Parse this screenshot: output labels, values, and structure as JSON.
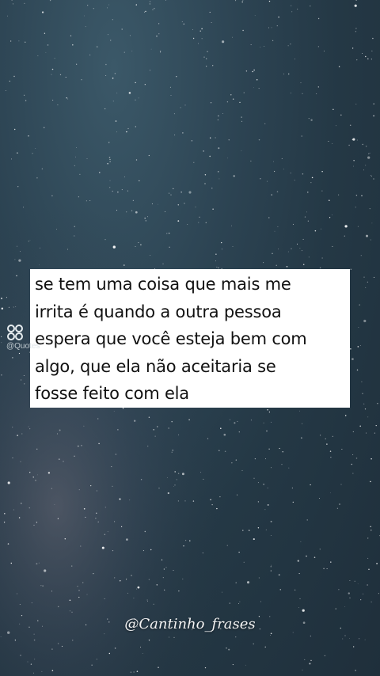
{
  "quote": {
    "lines": [
      "se tem uma coisa que mais me",
      "irrita é quando a outra pessoa",
      "espera que você esteja bem com",
      "algo, que ela não aceitaria se",
      "fosse feito com ela"
    ]
  },
  "watermark": {
    "icon": "quotes-app-icon",
    "handle": "@Quotes"
  },
  "credit": {
    "handle": "@Cantinho_frases"
  },
  "colors": {
    "sky_top": "#3b5868",
    "sky_bottom": "#1f2f3b",
    "box": "#ffffff",
    "text": "#111111"
  }
}
